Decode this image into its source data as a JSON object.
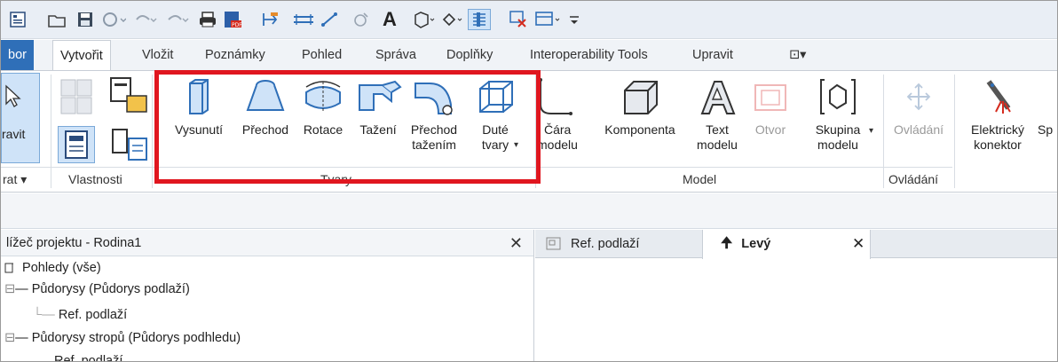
{
  "quick_access": {
    "icons": [
      "app-menu-icon",
      "open-icon",
      "save-icon",
      "sync-icon",
      "undo-icon",
      "redo-icon",
      "print-icon",
      "export-pdf-icon",
      "measure-icon",
      "dimension-icon",
      "align-icon",
      "tag-icon",
      "text-icon",
      "3d-view-icon",
      "section-icon",
      "thin-lines-icon",
      "close-windows-icon",
      "switch-windows-icon",
      "customize-icon"
    ],
    "text_glyph": "A"
  },
  "tabs": [
    {
      "label": "bor",
      "state": "partial"
    },
    {
      "label": "Vytvořit",
      "state": "active"
    },
    {
      "label": "Vložit"
    },
    {
      "label": "Poznámky"
    },
    {
      "label": "Pohled"
    },
    {
      "label": "Správa"
    },
    {
      "label": "Doplňky"
    },
    {
      "label": "Interoperability Tools"
    },
    {
      "label": "Upravit"
    },
    {
      "label": "⊡▾"
    }
  ],
  "ribbon": {
    "select": {
      "button": "ravit",
      "panel": "rat ▾"
    },
    "properties": {
      "panel": "Vlastnosti"
    },
    "forms": {
      "panel": "Tvary",
      "buttons": [
        {
          "line1": "Vysunutí",
          "line2": "",
          "icon": "extrusion-icon"
        },
        {
          "line1": "Přechod",
          "line2": "",
          "icon": "blend-icon"
        },
        {
          "line1": "Rotace",
          "line2": "",
          "icon": "revolve-icon"
        },
        {
          "line1": "Tažení",
          "line2": "",
          "icon": "sweep-icon"
        },
        {
          "line1": "Přechod",
          "line2": "tažením",
          "icon": "swept-blend-icon"
        },
        {
          "line1": "Duté",
          "line2": "tvary",
          "icon": "void-forms-icon"
        }
      ]
    },
    "model": {
      "panel": "Model",
      "buttons": [
        {
          "line1": "Čára",
          "line2": "modelu",
          "icon": "model-line-icon",
          "disabled": false
        },
        {
          "line1": "Komponenta",
          "line2": "",
          "icon": "component-icon",
          "disabled": false
        },
        {
          "line1": "Text",
          "line2": "modelu",
          "icon": "model-text-icon",
          "disabled": false
        },
        {
          "line1": "Otvor",
          "line2": "",
          "icon": "opening-icon",
          "disabled": true
        },
        {
          "line1": "Skupina",
          "line2": "modelu",
          "icon": "model-group-icon",
          "disabled": false
        }
      ]
    },
    "control": {
      "panel": "Ovládání",
      "button": "Ovládání"
    },
    "connectors": {
      "button1_line1": "Elektrický",
      "button1_line2": "konektor",
      "button2": "Sp"
    }
  },
  "project_browser": {
    "title": "lížeč projektu - Rodina1",
    "close": "✕",
    "items": [
      {
        "label": "Pohledy (vše)"
      },
      {
        "label": "Půdorysy (Půdorys podlaží)"
      },
      {
        "label": "Ref. podlaží"
      },
      {
        "label": "Půdorysy stropů (Půdorys podhledu)"
      },
      {
        "label": "Ref. podlaží"
      }
    ]
  },
  "view_tabs": [
    {
      "label": "Ref. podlaží",
      "active": false
    },
    {
      "label": "Levý",
      "active": true,
      "close": "✕"
    }
  ],
  "colors": {
    "highlight": "#e0161f",
    "accent": "#2f6fb8"
  }
}
